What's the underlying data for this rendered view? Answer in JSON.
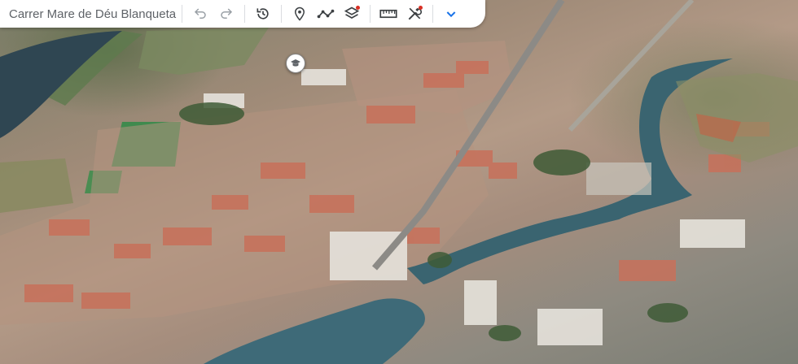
{
  "search": {
    "text": "Carrer Mare de Déu Blanqueta, G"
  },
  "toolbar": {
    "buttons": [
      {
        "icon": "undo-icon"
      },
      {
        "icon": "redo-icon"
      },
      {
        "icon": "history-icon"
      },
      {
        "icon": "placemark-icon"
      },
      {
        "icon": "path-icon"
      },
      {
        "icon": "layers-icon"
      },
      {
        "icon": "ruler-icon"
      },
      {
        "icon": "tools-icon"
      },
      {
        "icon": "chevron-down-icon"
      }
    ],
    "accent": "#1a73e8",
    "badge_color": "#d93025"
  },
  "map": {
    "poi_icon": "school-icon"
  }
}
